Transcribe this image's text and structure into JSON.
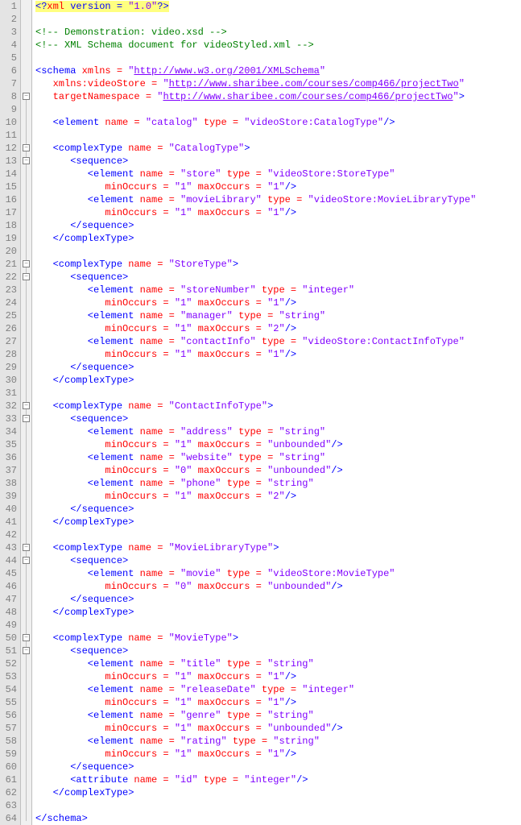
{
  "lineCount": 64,
  "foldBoxes": [
    8,
    12,
    13,
    21,
    22,
    32,
    33,
    43,
    44,
    50,
    51
  ],
  "foldLineStart": 8,
  "foldLineEnd": 64,
  "lines": [
    [
      [
        "hl blue",
        "<?"
      ],
      [
        "hl red",
        "xml "
      ],
      [
        "hl blue",
        "version = "
      ],
      [
        "hl purple",
        "\"1.0\""
      ],
      [
        "hl blue",
        "?>"
      ]
    ],
    [],
    [
      [
        "green",
        "<!-- Demonstration: video.xsd -->"
      ]
    ],
    [
      [
        "green",
        "<!-- XML Schema document for videoStyled.xml -->"
      ]
    ],
    [],
    [
      [
        "blue",
        "<schema "
      ],
      [
        "red",
        "xmlns = "
      ],
      [
        "purple",
        "\""
      ],
      [
        "purple underline",
        "http://www.w3.org/2001/XMLSchema"
      ],
      [
        "purple",
        "\""
      ]
    ],
    [
      [
        "blue",
        "   "
      ],
      [
        "red",
        "xmlns:videoStore = "
      ],
      [
        "purple",
        "\""
      ],
      [
        "purple underline",
        "http://www.sharibee.com/courses/comp466/projectTwo"
      ],
      [
        "purple",
        "\""
      ]
    ],
    [
      [
        "blue",
        "   "
      ],
      [
        "red",
        "targetNamespace = "
      ],
      [
        "purple",
        "\""
      ],
      [
        "purple underline",
        "http://www.sharibee.com/courses/comp466/projectTwo"
      ],
      [
        "purple",
        "\""
      ],
      [
        "blue",
        ">"
      ]
    ],
    [],
    [
      [
        "blue",
        "   <element "
      ],
      [
        "red",
        "name = "
      ],
      [
        "purple",
        "\"catalog\" "
      ],
      [
        "red",
        "type = "
      ],
      [
        "purple",
        "\"videoStore:CatalogType\""
      ],
      [
        "blue",
        "/>"
      ]
    ],
    [],
    [
      [
        "blue",
        "   <complexType "
      ],
      [
        "red",
        "name = "
      ],
      [
        "purple",
        "\"CatalogType\""
      ],
      [
        "blue",
        ">"
      ]
    ],
    [
      [
        "blue",
        "      <sequence>"
      ]
    ],
    [
      [
        "blue",
        "         <element "
      ],
      [
        "red",
        "name = "
      ],
      [
        "purple",
        "\"store\" "
      ],
      [
        "red",
        "type = "
      ],
      [
        "purple",
        "\"videoStore:StoreType\""
      ]
    ],
    [
      [
        "blue",
        "            "
      ],
      [
        "red",
        "minOccurs = "
      ],
      [
        "purple",
        "\"1\" "
      ],
      [
        "red",
        "maxOccurs = "
      ],
      [
        "purple",
        "\"1\""
      ],
      [
        "blue",
        "/>"
      ]
    ],
    [
      [
        "blue",
        "         <element "
      ],
      [
        "red",
        "name = "
      ],
      [
        "purple",
        "\"movieLibrary\" "
      ],
      [
        "red",
        "type = "
      ],
      [
        "purple",
        "\"videoStore:MovieLibraryType\""
      ]
    ],
    [
      [
        "blue",
        "            "
      ],
      [
        "red",
        "minOccurs = "
      ],
      [
        "purple",
        "\"1\" "
      ],
      [
        "red",
        "maxOccurs = "
      ],
      [
        "purple",
        "\"1\""
      ],
      [
        "blue",
        "/>"
      ]
    ],
    [
      [
        "blue",
        "      </sequence>"
      ]
    ],
    [
      [
        "blue",
        "   </complexType>"
      ]
    ],
    [],
    [
      [
        "blue",
        "   <complexType "
      ],
      [
        "red",
        "name = "
      ],
      [
        "purple",
        "\"StoreType\""
      ],
      [
        "blue",
        ">"
      ]
    ],
    [
      [
        "blue",
        "      <sequence>"
      ]
    ],
    [
      [
        "blue",
        "         <element "
      ],
      [
        "red",
        "name = "
      ],
      [
        "purple",
        "\"storeNumber\" "
      ],
      [
        "red",
        "type = "
      ],
      [
        "purple",
        "\"integer\""
      ]
    ],
    [
      [
        "blue",
        "            "
      ],
      [
        "red",
        "minOccurs = "
      ],
      [
        "purple",
        "\"1\" "
      ],
      [
        "red",
        "maxOccurs = "
      ],
      [
        "purple",
        "\"1\""
      ],
      [
        "blue",
        "/>"
      ]
    ],
    [
      [
        "blue",
        "         <element "
      ],
      [
        "red",
        "name = "
      ],
      [
        "purple",
        "\"manager\" "
      ],
      [
        "red",
        "type = "
      ],
      [
        "purple",
        "\"string\""
      ]
    ],
    [
      [
        "blue",
        "            "
      ],
      [
        "red",
        "minOccurs = "
      ],
      [
        "purple",
        "\"1\" "
      ],
      [
        "red",
        "maxOccurs = "
      ],
      [
        "purple",
        "\"2\""
      ],
      [
        "blue",
        "/>"
      ]
    ],
    [
      [
        "blue",
        "         <element "
      ],
      [
        "red",
        "name = "
      ],
      [
        "purple",
        "\"contactInfo\" "
      ],
      [
        "red",
        "type = "
      ],
      [
        "purple",
        "\"videoStore:ContactInfoType\""
      ]
    ],
    [
      [
        "blue",
        "            "
      ],
      [
        "red",
        "minOccurs = "
      ],
      [
        "purple",
        "\"1\" "
      ],
      [
        "red",
        "maxOccurs = "
      ],
      [
        "purple",
        "\"1\""
      ],
      [
        "blue",
        "/>"
      ]
    ],
    [
      [
        "blue",
        "      </sequence>"
      ]
    ],
    [
      [
        "blue",
        "   </complexType>"
      ]
    ],
    [],
    [
      [
        "blue",
        "   <complexType "
      ],
      [
        "red",
        "name = "
      ],
      [
        "purple",
        "\"ContactInfoType\""
      ],
      [
        "blue",
        ">"
      ]
    ],
    [
      [
        "blue",
        "      <sequence>"
      ]
    ],
    [
      [
        "blue",
        "         <element "
      ],
      [
        "red",
        "name = "
      ],
      [
        "purple",
        "\"address\" "
      ],
      [
        "red",
        "type = "
      ],
      [
        "purple",
        "\"string\""
      ]
    ],
    [
      [
        "blue",
        "            "
      ],
      [
        "red",
        "minOccurs = "
      ],
      [
        "purple",
        "\"1\" "
      ],
      [
        "red",
        "maxOccurs = "
      ],
      [
        "purple",
        "\"unbounded\""
      ],
      [
        "blue",
        "/>"
      ]
    ],
    [
      [
        "blue",
        "         <element "
      ],
      [
        "red",
        "name = "
      ],
      [
        "purple",
        "\"website\" "
      ],
      [
        "red",
        "type = "
      ],
      [
        "purple",
        "\"string\""
      ]
    ],
    [
      [
        "blue",
        "            "
      ],
      [
        "red",
        "minOccurs = "
      ],
      [
        "purple",
        "\"0\" "
      ],
      [
        "red",
        "maxOccurs = "
      ],
      [
        "purple",
        "\"unbounded\""
      ],
      [
        "blue",
        "/>"
      ]
    ],
    [
      [
        "blue",
        "         <element "
      ],
      [
        "red",
        "name = "
      ],
      [
        "purple",
        "\"phone\" "
      ],
      [
        "red",
        "type = "
      ],
      [
        "purple",
        "\"string\""
      ]
    ],
    [
      [
        "blue",
        "            "
      ],
      [
        "red",
        "minOccurs = "
      ],
      [
        "purple",
        "\"1\" "
      ],
      [
        "red",
        "maxOccurs = "
      ],
      [
        "purple",
        "\"2\""
      ],
      [
        "blue",
        "/>"
      ]
    ],
    [
      [
        "blue",
        "      </sequence>"
      ]
    ],
    [
      [
        "blue",
        "   </complexType>"
      ]
    ],
    [],
    [
      [
        "blue",
        "   <complexType "
      ],
      [
        "red",
        "name = "
      ],
      [
        "purple",
        "\"MovieLibraryType\""
      ],
      [
        "blue",
        ">"
      ]
    ],
    [
      [
        "blue",
        "      <sequence>"
      ]
    ],
    [
      [
        "blue",
        "         <element "
      ],
      [
        "red",
        "name = "
      ],
      [
        "purple",
        "\"movie\" "
      ],
      [
        "red",
        "type = "
      ],
      [
        "purple",
        "\"videoStore:MovieType\""
      ]
    ],
    [
      [
        "blue",
        "            "
      ],
      [
        "red",
        "minOccurs = "
      ],
      [
        "purple",
        "\"0\" "
      ],
      [
        "red",
        "maxOccurs = "
      ],
      [
        "purple",
        "\"unbounded\""
      ],
      [
        "blue",
        "/>"
      ]
    ],
    [
      [
        "blue",
        "      </sequence>"
      ]
    ],
    [
      [
        "blue",
        "   </complexType>"
      ]
    ],
    [],
    [
      [
        "blue",
        "   <complexType "
      ],
      [
        "red",
        "name = "
      ],
      [
        "purple",
        "\"MovieType\""
      ],
      [
        "blue",
        ">"
      ]
    ],
    [
      [
        "blue",
        "      <sequence>"
      ]
    ],
    [
      [
        "blue",
        "         <element "
      ],
      [
        "red",
        "name = "
      ],
      [
        "purple",
        "\"title\" "
      ],
      [
        "red",
        "type = "
      ],
      [
        "purple",
        "\"string\""
      ]
    ],
    [
      [
        "blue",
        "            "
      ],
      [
        "red",
        "minOccurs = "
      ],
      [
        "purple",
        "\"1\" "
      ],
      [
        "red",
        "maxOccurs = "
      ],
      [
        "purple",
        "\"1\""
      ],
      [
        "blue",
        "/>"
      ]
    ],
    [
      [
        "blue",
        "         <element "
      ],
      [
        "red",
        "name = "
      ],
      [
        "purple",
        "\"releaseDate\" "
      ],
      [
        "red",
        "type = "
      ],
      [
        "purple",
        "\"integer\""
      ]
    ],
    [
      [
        "blue",
        "            "
      ],
      [
        "red",
        "minOccurs = "
      ],
      [
        "purple",
        "\"1\" "
      ],
      [
        "red",
        "maxOccurs = "
      ],
      [
        "purple",
        "\"1\""
      ],
      [
        "blue",
        "/>"
      ]
    ],
    [
      [
        "blue",
        "         <element "
      ],
      [
        "red",
        "name = "
      ],
      [
        "purple",
        "\"genre\" "
      ],
      [
        "red",
        "type = "
      ],
      [
        "purple",
        "\"string\""
      ]
    ],
    [
      [
        "blue",
        "            "
      ],
      [
        "red",
        "minOccurs = "
      ],
      [
        "purple",
        "\"1\" "
      ],
      [
        "red",
        "maxOccurs = "
      ],
      [
        "purple",
        "\"unbounded\""
      ],
      [
        "blue",
        "/>"
      ]
    ],
    [
      [
        "blue",
        "         <element "
      ],
      [
        "red",
        "name = "
      ],
      [
        "purple",
        "\"rating\" "
      ],
      [
        "red",
        "type = "
      ],
      [
        "purple",
        "\"string\""
      ]
    ],
    [
      [
        "blue",
        "            "
      ],
      [
        "red",
        "minOccurs = "
      ],
      [
        "purple",
        "\"1\" "
      ],
      [
        "red",
        "maxOccurs = "
      ],
      [
        "purple",
        "\"1\""
      ],
      [
        "blue",
        "/>"
      ]
    ],
    [
      [
        "blue",
        "      </sequence>"
      ]
    ],
    [
      [
        "blue",
        "      <attribute "
      ],
      [
        "red",
        "name = "
      ],
      [
        "purple",
        "\"id\" "
      ],
      [
        "red",
        "type = "
      ],
      [
        "purple",
        "\"integer\""
      ],
      [
        "blue",
        "/>"
      ]
    ],
    [
      [
        "blue",
        "   </complexType>"
      ]
    ],
    [],
    [
      [
        "blue",
        "</schema>"
      ]
    ]
  ]
}
